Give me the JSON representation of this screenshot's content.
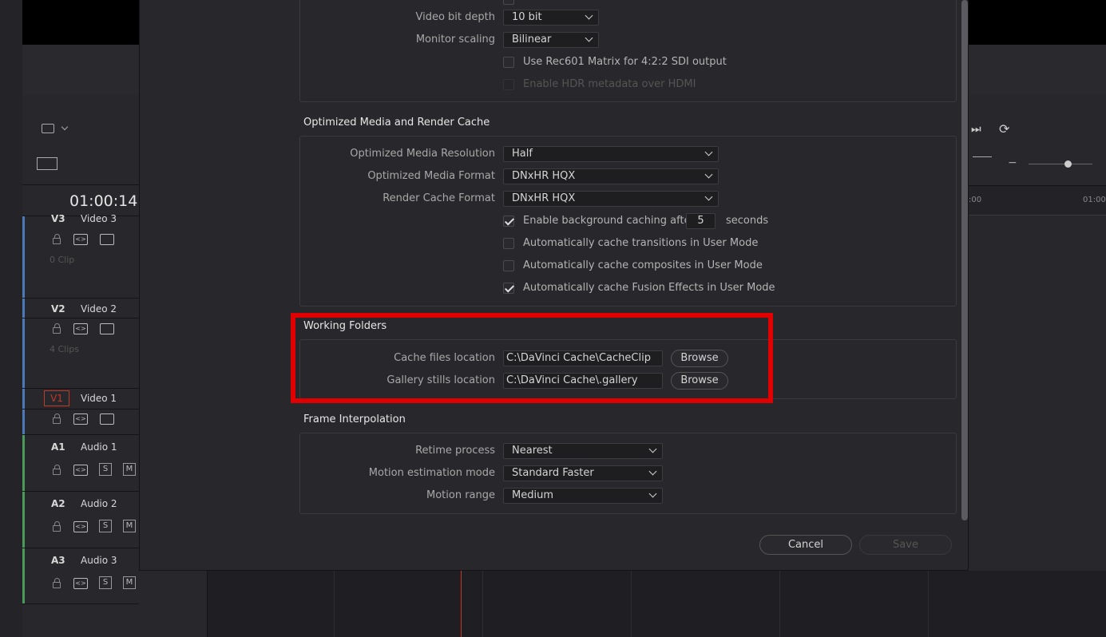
{
  "timeline": {
    "timecode": "01:00:14",
    "tracks": [
      {
        "id": "V3",
        "name": "Video 3",
        "clips": "0 Clip"
      },
      {
        "id": "V2",
        "name": "Video 2",
        "clips": "4 Clips"
      },
      {
        "id": "V1",
        "name": "Video 1",
        "clips": ""
      },
      {
        "id": "A1",
        "name": "Audio 1"
      },
      {
        "id": "A2",
        "name": "Audio 2"
      },
      {
        "id": "A3",
        "name": "Audio 3"
      }
    ],
    "solo_label": "S",
    "mute_label": "M",
    "ruler_left": ":00",
    "ruler_right": "01:00"
  },
  "dialog": {
    "video_bit_depth_label": "Video bit depth",
    "video_bit_depth_value": "10 bit",
    "monitor_scaling_label": "Monitor scaling",
    "monitor_scaling_value": "Bilinear",
    "rec601_label": "Use Rec601 Matrix for 4:2:2 SDI output",
    "hdr_label": "Enable HDR metadata over HDMI",
    "optimized": {
      "title": "Optimized Media and Render Cache",
      "resolution_label": "Optimized Media Resolution",
      "resolution_value": "Half",
      "format_label": "Optimized Media Format",
      "format_value": "DNxHR HQX",
      "render_format_label": "Render Cache Format",
      "render_format_value": "DNxHR HQX",
      "bg_cache_label": "Enable background caching after",
      "bg_cache_value": "5",
      "bg_cache_unit": "seconds",
      "auto_transitions_label": "Automatically cache transitions in User Mode",
      "auto_composites_label": "Automatically cache composites in User Mode",
      "auto_fusion_label": "Automatically cache Fusion Effects in User Mode"
    },
    "working_folders": {
      "title": "Working Folders",
      "cache_label": "Cache files location",
      "cache_value": "C:\\DaVinci Cache\\CacheClip",
      "gallery_label": "Gallery stills location",
      "gallery_value": "C:\\DaVinci Cache\\.gallery",
      "browse_label": "Browse"
    },
    "frame_interp": {
      "title": "Frame Interpolation",
      "retime_label": "Retime process",
      "retime_value": "Nearest",
      "motion_label": "Motion estimation mode",
      "motion_value": "Standard Faster",
      "range_label": "Motion range",
      "range_value": "Medium"
    },
    "cancel_label": "Cancel",
    "save_label": "Save"
  },
  "colors": {
    "highlight": "#e00000",
    "v_track": "#4a7ab8",
    "a_track": "#4a9a5a"
  }
}
